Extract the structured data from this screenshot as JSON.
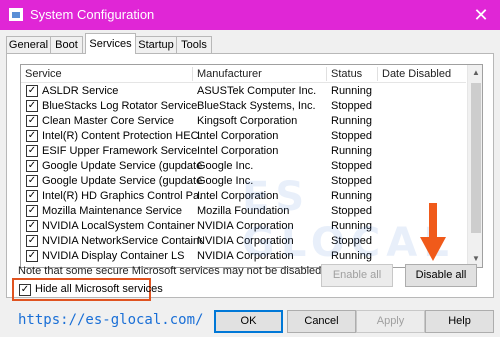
{
  "window": {
    "title": "System Configuration",
    "close_glyph": "✕"
  },
  "tabs": [
    {
      "label": "General"
    },
    {
      "label": "Boot"
    },
    {
      "label": "Services",
      "active": true
    },
    {
      "label": "Startup"
    },
    {
      "label": "Tools"
    }
  ],
  "list": {
    "columns": [
      "Service",
      "Manufacturer",
      "Status",
      "Date Disabled"
    ],
    "rows": [
      {
        "name": "ASLDR Service",
        "manufacturer": "ASUSTek Computer Inc.",
        "status": "Running",
        "checked": true
      },
      {
        "name": "BlueStacks Log Rotator Service",
        "manufacturer": "BlueStack Systems, Inc.",
        "status": "Stopped",
        "checked": true
      },
      {
        "name": "Clean Master Core Service",
        "manufacturer": "Kingsoft Corporation",
        "status": "Running",
        "checked": true
      },
      {
        "name": "Intel(R) Content Protection HEC...",
        "manufacturer": "Intel Corporation",
        "status": "Stopped",
        "checked": true
      },
      {
        "name": "ESIF Upper Framework Service",
        "manufacturer": "Intel Corporation",
        "status": "Running",
        "checked": true
      },
      {
        "name": "Google Update Service (gupdate)",
        "manufacturer": "Google Inc.",
        "status": "Stopped",
        "checked": true
      },
      {
        "name": "Google Update Service (gupdatem)",
        "manufacturer": "Google Inc.",
        "status": "Stopped",
        "checked": true
      },
      {
        "name": "Intel(R) HD Graphics Control Pa...",
        "manufacturer": "Intel Corporation",
        "status": "Running",
        "checked": true
      },
      {
        "name": "Mozilla Maintenance Service",
        "manufacturer": "Mozilla Foundation",
        "status": "Stopped",
        "checked": true
      },
      {
        "name": "NVIDIA LocalSystem Container",
        "manufacturer": "NVIDIA Corporation",
        "status": "Running",
        "checked": true
      },
      {
        "name": "NVIDIA NetworkService Container",
        "manufacturer": "NVIDIA Corporation",
        "status": "Stopped",
        "checked": true
      },
      {
        "name": "NVIDIA Display Container LS",
        "manufacturer": "NVIDIA Corporation",
        "status": "Running",
        "checked": true
      }
    ],
    "scroll_up_icon": "▲",
    "scroll_down_icon": "▼"
  },
  "note": "Note that some secure Microsoft services may not be disabled.",
  "buttons": {
    "enable_all": "Enable all",
    "disable_all": "Disable all",
    "ok": "OK",
    "cancel": "Cancel",
    "apply": "Apply",
    "help": "Help"
  },
  "hide_ms": {
    "label": "Hide all Microsoft services",
    "checked": true
  },
  "overlay": {
    "url": "https://es-glocal.com/",
    "watermark": "ES GLOCAL",
    "arrow_color": "#f05a1a",
    "highlight_color": "#e05320"
  },
  "colors": {
    "titlebar": "#e026d6",
    "primary_button_border": "#0078d7",
    "url": "#1a6fd6"
  }
}
